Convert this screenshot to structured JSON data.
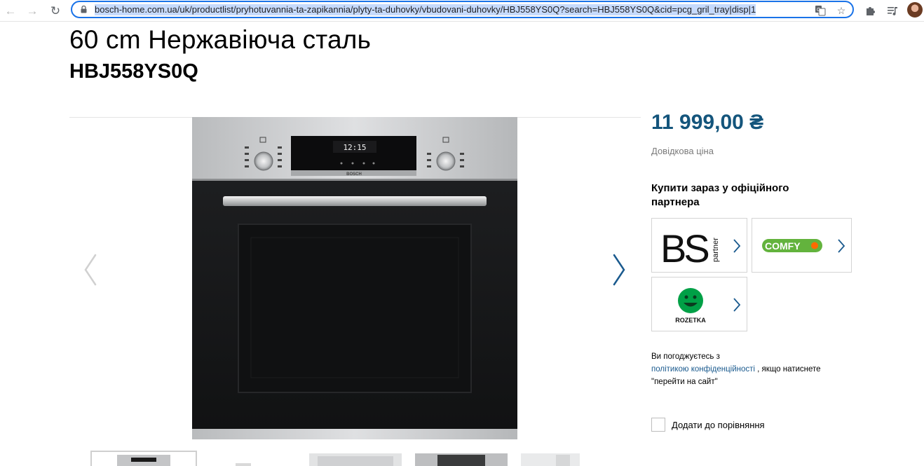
{
  "browser": {
    "back_icon": "←",
    "forward_icon": "→",
    "reload_icon": "↻",
    "url": "bosch-home.com.ua/uk/productlist/pryhotuvannia-ta-zapikannia/plyty-ta-duhovky/vbudovani-duhovky/HBJ558YS0Q?search=HBJ558YS0Q&cid=pcg_gril_tray|disp|1",
    "translate_icon": "⟰",
    "star_icon": "☆",
    "extensions_icon": "✦",
    "media_icon": "≡"
  },
  "product": {
    "title": "60 cm Нержавіюча сталь",
    "model": "HBJ558YS0Q",
    "price": "11 999,00 ₴",
    "reference_price_label": "Довідкова ціна",
    "oven_display_time": "12:15",
    "oven_brand": "BOSCH"
  },
  "buy": {
    "heading": "Купити зараз у офіційного партнера",
    "partners": [
      {
        "name": "BS partner",
        "logo_text": "BS",
        "logo_sub": "partner"
      },
      {
        "name": "COMFY",
        "logo_text": "COMFY"
      },
      {
        "name": "ROZETKA",
        "logo_text": "ROZETKA"
      }
    ]
  },
  "consent": {
    "line1": "Ви погоджуєтесь з",
    "link": "політикою конфіденційності",
    "line2": ", якщо натиснете",
    "line3": "\"перейти на сайт\""
  },
  "compare": {
    "label": "Додати до порівняння",
    "checked": false
  },
  "colors": {
    "price": "#14557c",
    "link": "#1a5a8e",
    "omnibox_focus": "#1a73e8",
    "comfy_green": "#63b33d",
    "comfy_orange": "#ff6a00",
    "rozetka_green": "#00a046",
    "gallery_arrow": "#1a5a8e"
  }
}
